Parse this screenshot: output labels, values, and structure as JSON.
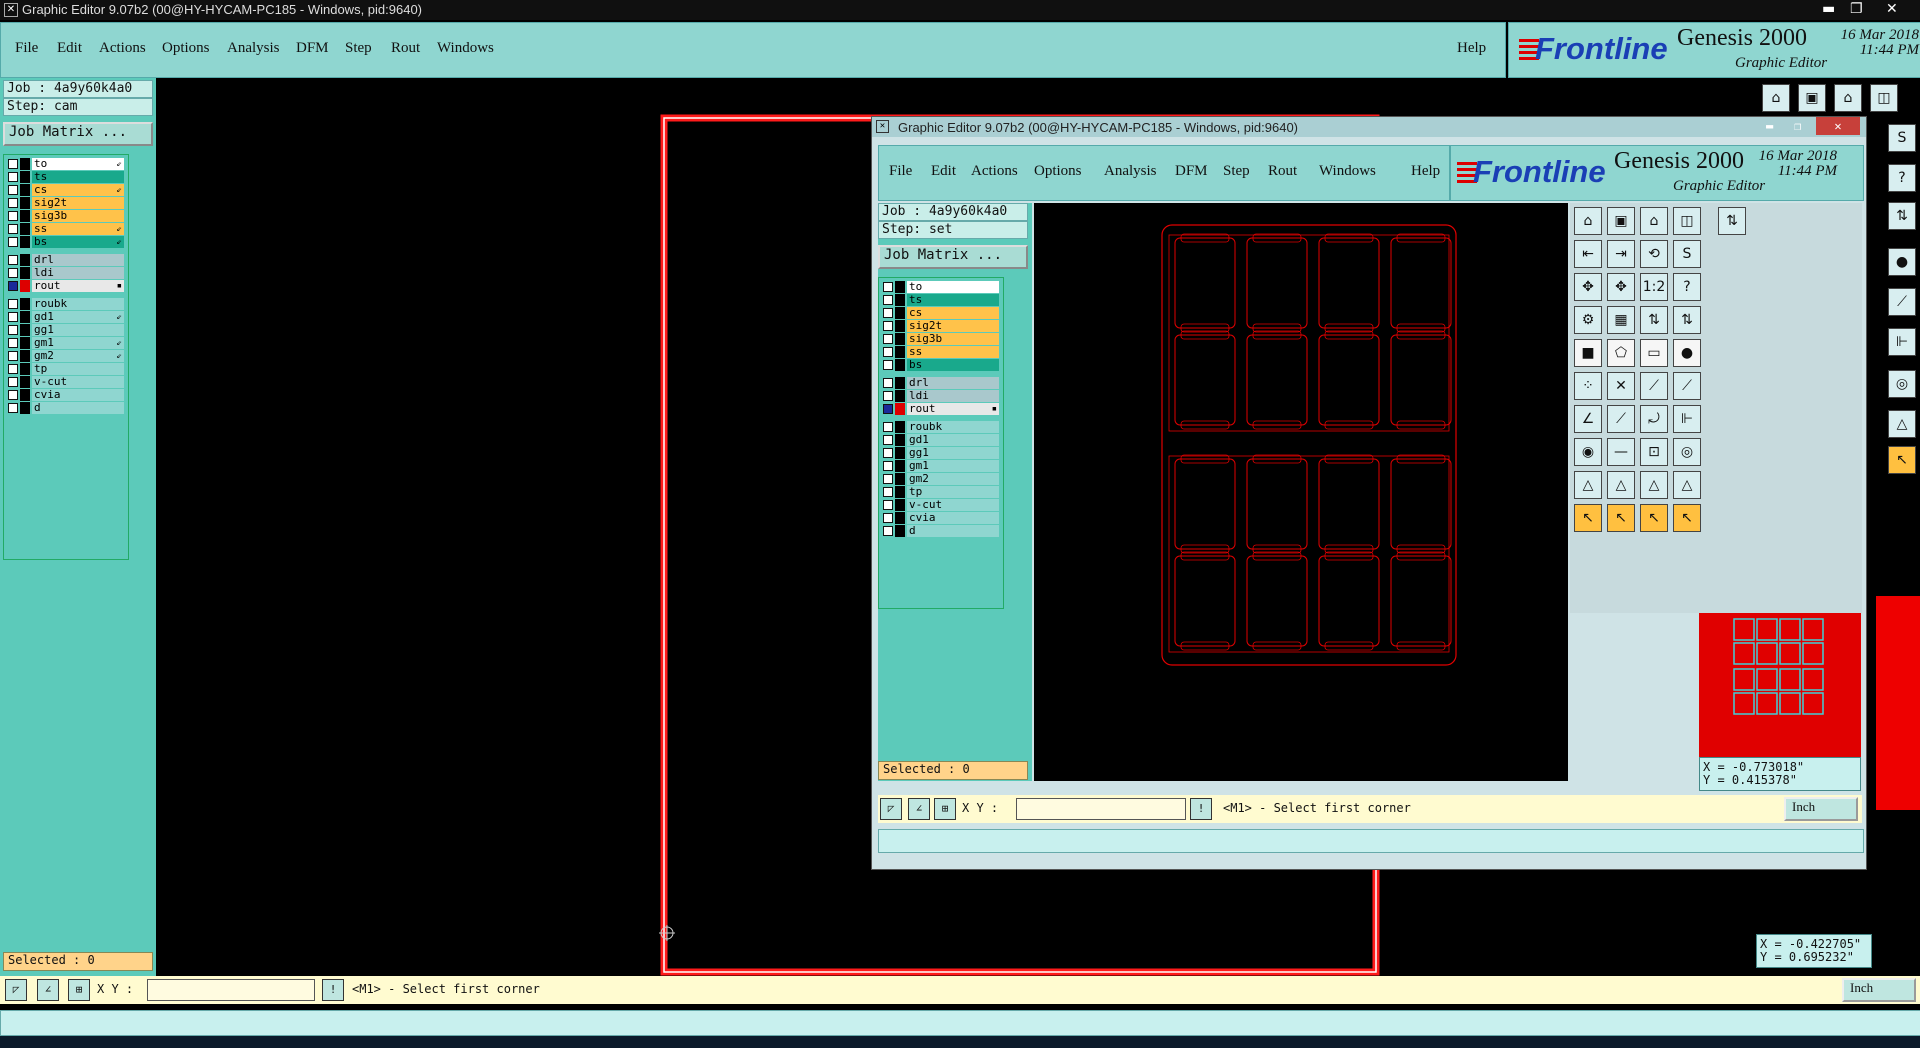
{
  "outer": {
    "title": "Graphic Editor 9.07b2 (00@HY-HYCAM-PC185 - Windows, pid:9640)",
    "menu": [
      "File",
      "Edit",
      "Actions",
      "Options",
      "Analysis",
      "DFM",
      "Step",
      "Rout",
      "Windows"
    ],
    "help": "Help",
    "brand": {
      "logo": "Frontline",
      "product": "Genesis 2000",
      "sub": "Graphic Editor",
      "date": "16 Mar 2018",
      "time": "11:44 PM"
    },
    "job": "Job : 4a9y60k4a0",
    "step": "Step: cam",
    "job_matrix": "Job Matrix ...",
    "selected": "Selected : 0",
    "xy_label": "X Y :",
    "xy_value": "",
    "excl": "!",
    "prompt": "<M1> - Select first corner",
    "unit": "Inch",
    "coords": {
      "x": "X = -0.422705\"",
      "y": "Y = 0.695232\""
    },
    "layers": [
      {
        "name": "to",
        "color": "#ffffff",
        "mark": "⇙"
      },
      {
        "name": "ts",
        "color": "#19a98c",
        "mark": ""
      },
      {
        "name": "cs",
        "color": "#ffc24a",
        "mark": "⇙"
      },
      {
        "name": "sig2t",
        "color": "#ffc24a",
        "mark": ""
      },
      {
        "name": "sig3b",
        "color": "#ffc24a",
        "mark": ""
      },
      {
        "name": "ss",
        "color": "#ffc24a",
        "mark": "⇙"
      },
      {
        "name": "bs",
        "color": "#19a98c",
        "mark": "⇙"
      },
      {
        "name": "drl",
        "color": "#a9c8cc",
        "mark": ""
      },
      {
        "name": "ldi",
        "color": "#a9c8cc",
        "mark": ""
      },
      {
        "name": "rout",
        "color": "#e8e8e8",
        "mark": "▪",
        "on": true
      },
      {
        "name": "roubk",
        "color": "#8fd6d0",
        "mark": ""
      },
      {
        "name": "gd1",
        "color": "#8fd6d0",
        "mark": "⇙"
      },
      {
        "name": "gg1",
        "color": "#8fd6d0",
        "mark": ""
      },
      {
        "name": "gm1",
        "color": "#8fd6d0",
        "mark": "⇙"
      },
      {
        "name": "gm2",
        "color": "#8fd6d0",
        "mark": "⇙"
      },
      {
        "name": "tp",
        "color": "#8fd6d0",
        "mark": ""
      },
      {
        "name": "v-cut",
        "color": "#8fd6d0",
        "mark": ""
      },
      {
        "name": "cvia",
        "color": "#8fd6d0",
        "mark": ""
      },
      {
        "name": "d",
        "color": "#8fd6d0",
        "mark": ""
      }
    ]
  },
  "inner": {
    "title": "Graphic Editor 9.07b2 (00@HY-HYCAM-PC185 - Windows, pid:9640)",
    "menu": [
      "File",
      "Edit",
      "Actions",
      "Options",
      "Analysis",
      "DFM",
      "Step",
      "Rout",
      "Windows"
    ],
    "help": "Help",
    "brand": {
      "logo": "Frontline",
      "product": "Genesis 2000",
      "sub": "Graphic Editor",
      "date": "16 Mar 2018",
      "time": "11:44 PM"
    },
    "job": "Job : 4a9y60k4a0",
    "step": "Step: set",
    "job_matrix": "Job Matrix ...",
    "selected": "Selected : 0",
    "xy_label": "X Y :",
    "xy_value": "",
    "excl": "!",
    "prompt": "<M1> - Select first corner",
    "unit": "Inch",
    "coords": {
      "x": "X = -0.773018\"",
      "y": "Y = 0.415378\""
    },
    "layers": [
      {
        "name": "to",
        "color": "#ffffff",
        "mark": ""
      },
      {
        "name": "ts",
        "color": "#19a98c",
        "mark": ""
      },
      {
        "name": "cs",
        "color": "#ffc24a",
        "mark": ""
      },
      {
        "name": "sig2t",
        "color": "#ffc24a",
        "mark": ""
      },
      {
        "name": "sig3b",
        "color": "#ffc24a",
        "mark": ""
      },
      {
        "name": "ss",
        "color": "#ffc24a",
        "mark": ""
      },
      {
        "name": "bs",
        "color": "#19a98c",
        "mark": ""
      },
      {
        "name": "drl",
        "color": "#a9c8cc",
        "mark": ""
      },
      {
        "name": "ldi",
        "color": "#a9c8cc",
        "mark": ""
      },
      {
        "name": "rout",
        "color": "#e8e8e8",
        "mark": "▪",
        "on": true
      },
      {
        "name": "roubk",
        "color": "#8fd6d0",
        "mark": ""
      },
      {
        "name": "gd1",
        "color": "#8fd6d0",
        "mark": ""
      },
      {
        "name": "gg1",
        "color": "#8fd6d0",
        "mark": ""
      },
      {
        "name": "gm1",
        "color": "#8fd6d0",
        "mark": ""
      },
      {
        "name": "gm2",
        "color": "#8fd6d0",
        "mark": ""
      },
      {
        "name": "tp",
        "color": "#8fd6d0",
        "mark": ""
      },
      {
        "name": "v-cut",
        "color": "#8fd6d0",
        "mark": ""
      },
      {
        "name": "cvia",
        "color": "#8fd6d0",
        "mark": ""
      },
      {
        "name": "d",
        "color": "#8fd6d0",
        "mark": ""
      }
    ]
  },
  "colors": {
    "panel": "#5ccaba",
    "menubar": "#8fd6d0",
    "outline": "#e00000",
    "canvas": "#000000"
  }
}
